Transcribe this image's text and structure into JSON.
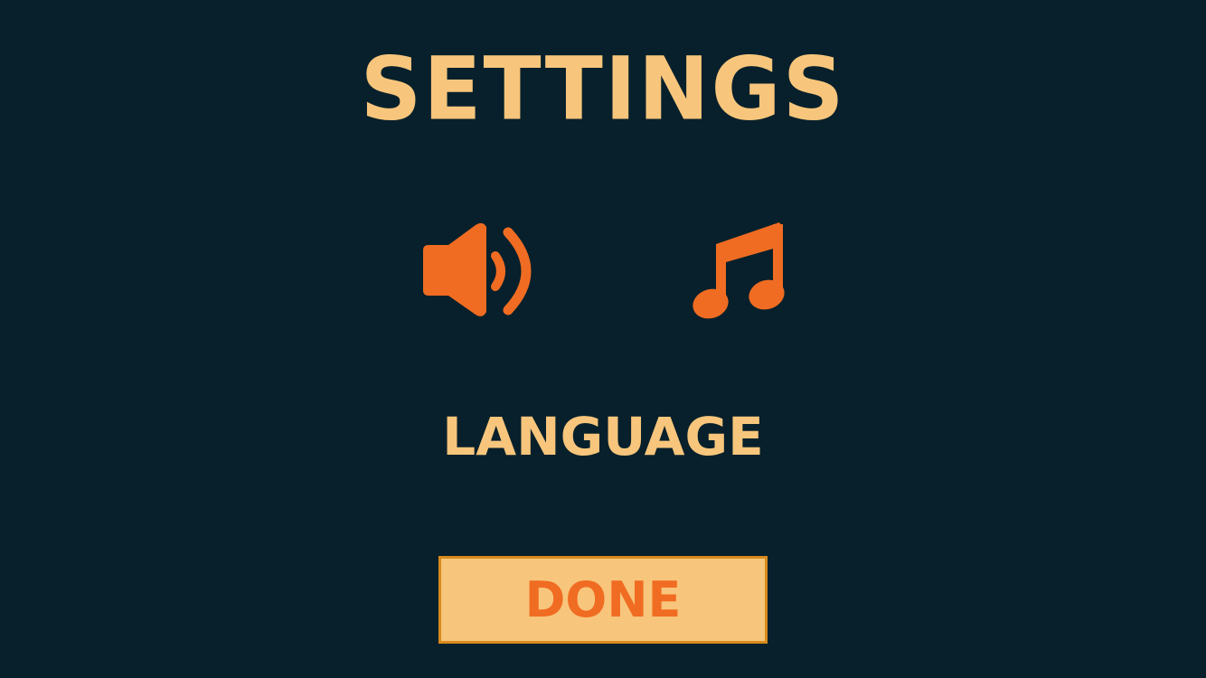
{
  "screen": {
    "title": "SETTINGS",
    "language_label": "LANGUAGE",
    "done_label": "DONE"
  },
  "icons": {
    "sound": "speaker-icon",
    "music": "music-note-icon"
  },
  "colors": {
    "background": "#08202b",
    "title_text": "#f7c67c",
    "icon_accent": "#f06c22",
    "button_fill": "#f7c67c",
    "button_border": "#d88b1c",
    "button_text": "#f06c22"
  }
}
